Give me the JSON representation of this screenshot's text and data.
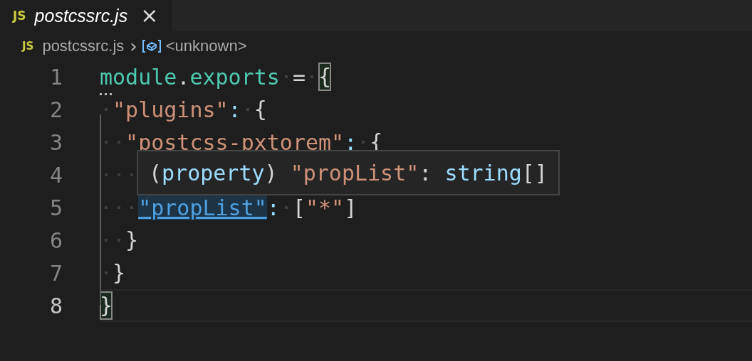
{
  "tab": {
    "icon": "JS",
    "title": "postcssrc.js",
    "close": "×",
    "selected": true
  },
  "breadcrumbs": {
    "icon": "JS",
    "file": "postcssrc.js",
    "separator": "›",
    "symbol": "<unknown>"
  },
  "lines": [
    {
      "number": "1",
      "current": false,
      "tokens": [
        {
          "kind": "type",
          "text": "module"
        },
        {
          "kind": "punct",
          "text": "."
        },
        {
          "kind": "type",
          "text": "exports"
        },
        {
          "kind": "ws"
        },
        {
          "kind": "punct",
          "text": "="
        },
        {
          "kind": "ws"
        },
        {
          "kind": "brace",
          "text": "{",
          "matched": true
        }
      ]
    },
    {
      "number": "2",
      "current": false,
      "tokens": [
        {
          "kind": "ws"
        },
        {
          "kind": "string",
          "text": "\"plugins\""
        },
        {
          "kind": "colon",
          "text": ":"
        },
        {
          "kind": "ws"
        },
        {
          "kind": "brace",
          "text": "{",
          "matched": false
        }
      ]
    },
    {
      "number": "3",
      "current": false,
      "tokens": [
        {
          "kind": "ws"
        },
        {
          "kind": "ws"
        },
        {
          "kind": "string",
          "text": "\"postcss-pxtorem\""
        },
        {
          "kind": "colon",
          "text": ":"
        },
        {
          "kind": "ws"
        },
        {
          "kind": "brace",
          "text": "{",
          "matched": false
        }
      ]
    },
    {
      "number": "4",
      "current": false,
      "tokens": [
        {
          "kind": "ws"
        },
        {
          "kind": "ws"
        },
        {
          "kind": "ws"
        }
      ]
    },
    {
      "number": "5",
      "current": false,
      "tokens": [
        {
          "kind": "ws"
        },
        {
          "kind": "ws"
        },
        {
          "kind": "ws"
        },
        {
          "kind": "link",
          "text": "\"propList\""
        },
        {
          "kind": "colon",
          "text": ":"
        },
        {
          "kind": "ws"
        },
        {
          "kind": "punct",
          "text": "["
        },
        {
          "kind": "string",
          "text": "\"*\""
        },
        {
          "kind": "punct",
          "text": "]"
        }
      ]
    },
    {
      "number": "6",
      "current": false,
      "tokens": [
        {
          "kind": "ws"
        },
        {
          "kind": "ws"
        },
        {
          "kind": "brace",
          "text": "}",
          "matched": false
        }
      ]
    },
    {
      "number": "7",
      "current": false,
      "tokens": [
        {
          "kind": "ws"
        },
        {
          "kind": "brace",
          "text": "}",
          "matched": false
        }
      ]
    },
    {
      "number": "8",
      "current": true,
      "tokens": [
        {
          "kind": "brace",
          "text": "}",
          "matched": true
        }
      ]
    }
  ],
  "hover": {
    "tokens": [
      {
        "kind": "punct",
        "text": "("
      },
      {
        "kind": "keyword",
        "text": "property"
      },
      {
        "kind": "punct",
        "text": ") "
      },
      {
        "kind": "string",
        "text": "\"propList\""
      },
      {
        "kind": "punct",
        "text": ": "
      },
      {
        "kind": "keyword",
        "text": "string"
      },
      {
        "kind": "punct",
        "text": "[]"
      }
    ]
  }
}
